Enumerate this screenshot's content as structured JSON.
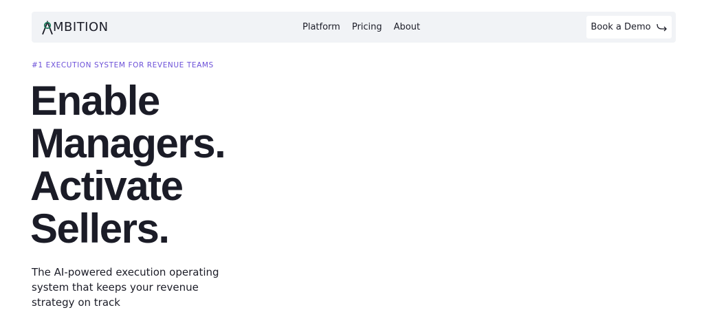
{
  "nav": {
    "logo_text": "MBITION",
    "links": [
      "Platform",
      "Pricing",
      "About"
    ],
    "cta_label": "Book a Demo"
  },
  "hero": {
    "eyebrow": "#1 EXECUTION SYSTEM FOR REVENUE TEAMS",
    "headline_lines": [
      "Enable",
      "Managers.",
      "Activate",
      "Sellers."
    ],
    "subhead": "The AI-powered execution operating system that keeps your revenue strategy on track"
  },
  "colors": {
    "logo_accent": "#1f7a5c",
    "eyebrow": "#6b4fd8",
    "nav_bg": "#f1f3f6",
    "text": "#1b1c27"
  },
  "icons": {
    "logo": "ambition-a-mark-icon",
    "cta": "arrow-turn-right-icon"
  }
}
